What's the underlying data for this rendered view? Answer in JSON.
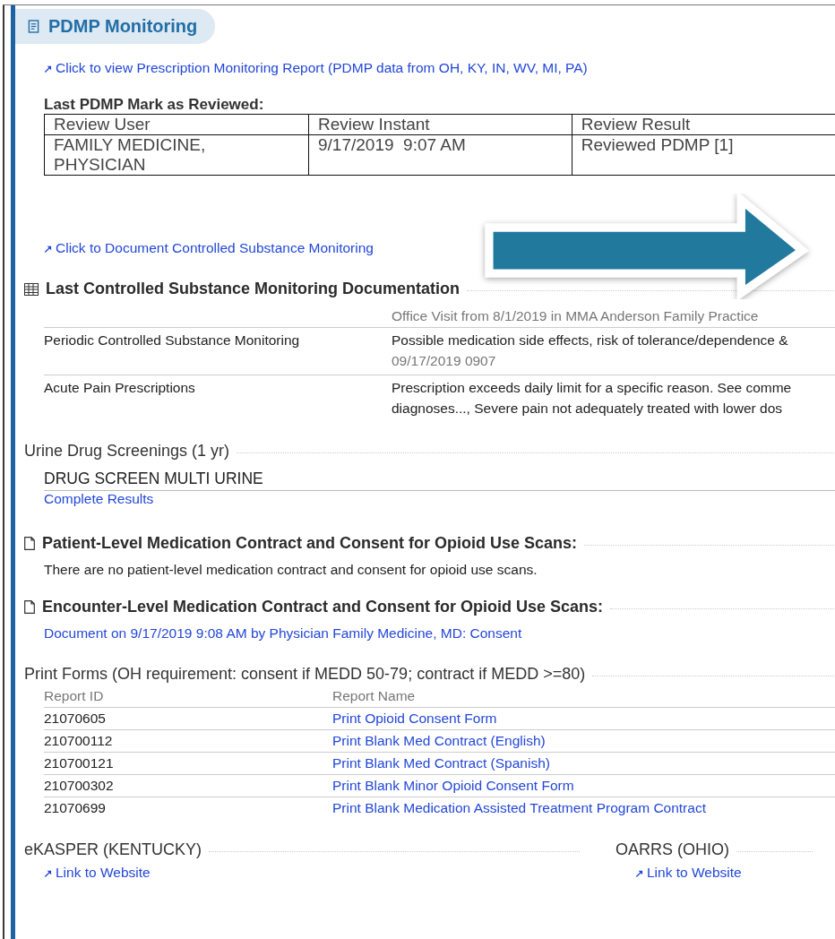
{
  "header": {
    "title": "PDMP Monitoring"
  },
  "report_link": "Click to view Prescription Monitoring Report (PDMP data from OH, KY, IN, WV, MI, PA)",
  "review": {
    "heading": "Last PDMP Mark as Reviewed:",
    "columns": [
      "Review User",
      "Review Instant",
      "Review Result"
    ],
    "rows": [
      [
        "FAMILY MEDICINE, PHYSICIAN",
        "9/17/2019  9:07 AM",
        "Reviewed PDMP [1]"
      ]
    ]
  },
  "document_link": "Click to Document Controlled Substance Monitoring",
  "monitoring": {
    "heading": "Last Controlled Substance Monitoring Documentation",
    "encounter": "Office Visit from 8/1/2019 in MMA Anderson Family Practice",
    "rows": [
      {
        "label": "Periodic Controlled Substance Monitoring",
        "lines": [
          "Possible medication side effects, risk of tolerance/dependence &"
        ],
        "timestamp": "09/17/2019 0907"
      },
      {
        "label": "Acute Pain Prescriptions",
        "lines": [
          "Prescription exceeds daily limit for a specific reason. See comme",
          "diagnoses..., Severe pain not adequately treated with lower dos"
        ]
      }
    ]
  },
  "urine": {
    "heading": "Urine Drug Screenings (1 yr)",
    "tests": [
      {
        "name": "DRUG SCREEN MULTI URINE",
        "link": "Complete Results"
      }
    ]
  },
  "scans": [
    {
      "heading": "Patient-Level Medication Contract and Consent for Opioid Use Scans:",
      "kind": "text",
      "body": "There are no patient-level medication contract and consent for opioid use scans."
    },
    {
      "heading": "Encounter-Level Medication Contract and Consent for Opioid Use Scans:",
      "kind": "link",
      "body": "Document on 9/17/2019 9:08 AM by Physician Family Medicine, MD: Consent"
    }
  ],
  "print_forms": {
    "heading": "Print Forms (OH requirement: consent if MEDD 50-79; contract if MEDD >=80)",
    "columns": [
      "Report ID",
      "Report Name"
    ],
    "rows": [
      {
        "id": "21070605",
        "name": "Print Opioid Consent Form"
      },
      {
        "id": "210700112",
        "name": "Print Blank Med Contract (English)"
      },
      {
        "id": "210700121",
        "name": "Print Blank Med Contract (Spanish)"
      },
      {
        "id": "210700302",
        "name": "Print Blank Minor Opioid Consent Form"
      },
      {
        "id": "21070699",
        "name": "Print Blank Medication Assisted Treatment Program Contract"
      }
    ]
  },
  "websites": [
    {
      "heading": "eKASPER (KENTUCKY)",
      "link": "Link to Website"
    },
    {
      "heading": "OARRS (OHIO)",
      "link": "Link to Website"
    }
  ]
}
